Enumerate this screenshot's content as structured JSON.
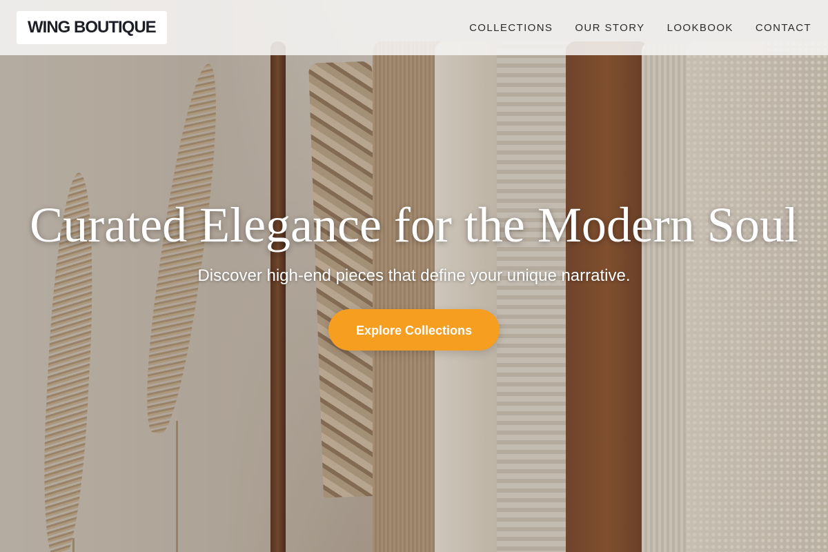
{
  "brand": {
    "logo_text": "WING BOUTIQUE"
  },
  "nav": {
    "items": [
      {
        "label": "COLLECTIONS"
      },
      {
        "label": "OUR STORY"
      },
      {
        "label": "LOOKBOOK"
      },
      {
        "label": "CONTACT"
      }
    ]
  },
  "hero": {
    "title": "Curated Elegance for the Modern Soul",
    "subtitle": "Discover high-end pieces that define your unique narrative.",
    "cta_label": "Explore Collections",
    "background_image": "clothing-rack-photo"
  },
  "colors": {
    "accent": "#f59e1f",
    "header_bg": "#f5f4f3",
    "logo_text": "#1d1f26",
    "hero_text": "#ffffff"
  }
}
